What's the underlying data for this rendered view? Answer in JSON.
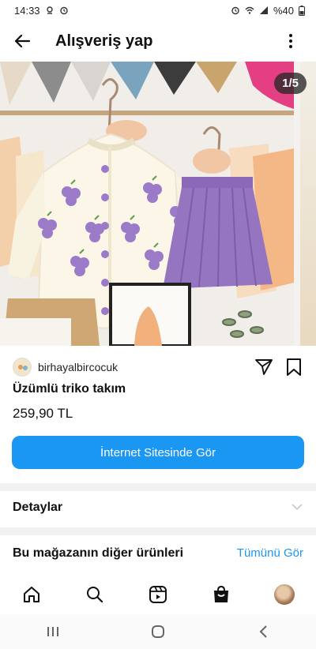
{
  "status_bar": {
    "time": "14:33",
    "battery": "%40"
  },
  "header": {
    "title": "Alışveriş yap"
  },
  "carousel": {
    "counter": "1/5"
  },
  "product": {
    "seller": "birhayalbircocuk",
    "name": "Üzümlü triko takım",
    "price": "259,90 TL",
    "cta_label": "İnternet Sitesinde Gör"
  },
  "details": {
    "label": "Detaylar"
  },
  "more_products": {
    "label": "Bu mağazanın diğer ürünleri",
    "see_all": "Tümünü Gör"
  },
  "bottom_nav": [
    "home-icon",
    "search-icon",
    "reels-icon",
    "shop-icon",
    "profile-avatar"
  ],
  "colors": {
    "accent": "#1a96f3",
    "cardigan": "#fbf6e8",
    "grape": "#9b7ac8",
    "skirt": "#9574c0"
  }
}
